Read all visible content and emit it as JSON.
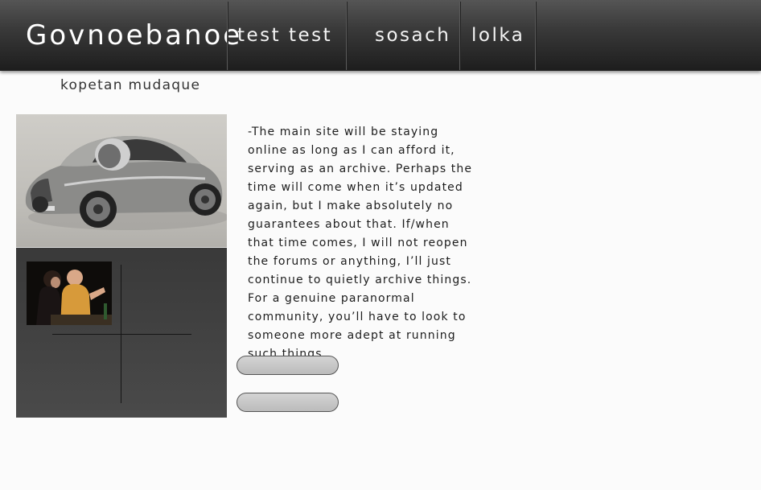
{
  "header": {
    "brand": "Govnoebanoe",
    "nav": [
      {
        "label": "test test"
      },
      {
        "label": "sosach"
      },
      {
        "label": "lolka"
      }
    ]
  },
  "subtitle": "kopetan mudaque",
  "main": {
    "paragraph": "-The main site will be staying online as long as I can afford it, serving as an archive. Perhaps the time will come when it’s updated again, but I make absolutely no guarantees about that. If/when that time comes, I will not reopen the forums or anything, I’ll just continue to quietly archive things. For a genuine paranormal community, you’ll have to look to someone more adept at running such things."
  }
}
